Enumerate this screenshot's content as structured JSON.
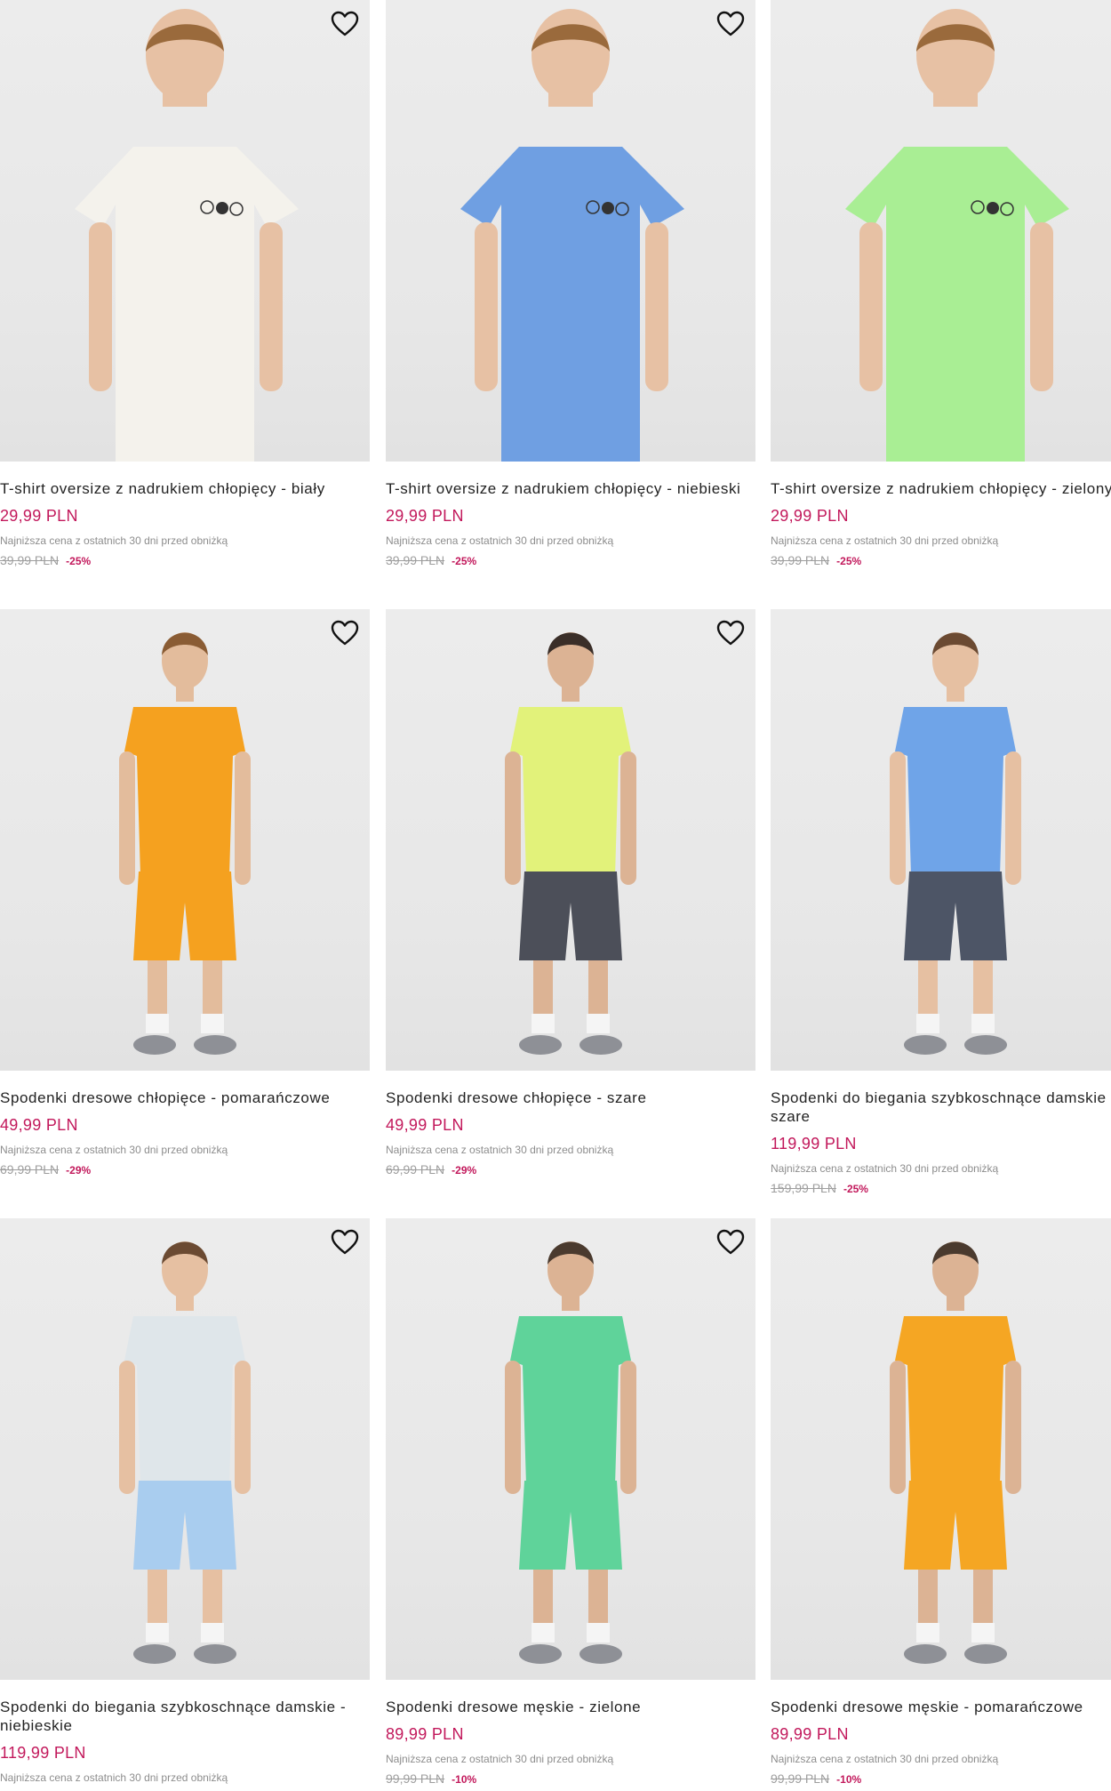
{
  "products": [
    {
      "title": "T-shirt oversize z nadrukiem chłopięcy - biały",
      "price": "29,99 PLN",
      "lowest_note": "Najniższa cena z ostatnich 30 dni przed obniżką",
      "old_price": "39,99 PLN",
      "discount": "-25%",
      "colors": {
        "top": "#f4f2ec",
        "bottom": "#f1eee6",
        "hair": "#9a6a3c",
        "skin": "#e7c1a4"
      }
    },
    {
      "title": "T-shirt oversize z nadrukiem chłopięcy - niebieski",
      "price": "29,99 PLN",
      "lowest_note": "Najniższa cena z ostatnich 30 dni przed obniżką",
      "old_price": "39,99 PLN",
      "discount": "-25%",
      "colors": {
        "top": "#6f9fe2",
        "bottom": "#6f9fe2",
        "hair": "#9a6a3c",
        "skin": "#e7c1a4"
      }
    },
    {
      "title": "T-shirt oversize z nadrukiem chłopięcy - zielony",
      "price": "29,99 PLN",
      "lowest_note": "Najniższa cena z ostatnich 30 dni przed obniżką",
      "old_price": "39,99 PLN",
      "discount": "-25%",
      "colors": {
        "top": "#a9ee94",
        "bottom": "#a9ee94",
        "hair": "#9a6a3c",
        "skin": "#e7c1a4"
      }
    },
    {
      "title": "Spodenki dresowe chłopięce - pomarańczowe",
      "price": "49,99 PLN",
      "lowest_note": "Najniższa cena z ostatnich 30 dni przed obniżką",
      "old_price": "69,99 PLN",
      "discount": "-29%",
      "colors": {
        "top": "#f5a11f",
        "bottom": "#f5a11f",
        "hair": "#8a5c34",
        "skin": "#e3bc9c"
      }
    },
    {
      "title": "Spodenki dresowe chłopięce - szare",
      "price": "49,99 PLN",
      "lowest_note": "Najniższa cena z ostatnich 30 dni przed obniżką",
      "old_price": "69,99 PLN",
      "discount": "-29%",
      "colors": {
        "top": "#e2f27a",
        "bottom": "#4c4f59",
        "hair": "#3a2e28",
        "skin": "#dcb394"
      }
    },
    {
      "title": "Spodenki do biegania szybkoschnące damskie - szare",
      "price": "119,99 PLN",
      "lowest_note": "Najniższa cena z ostatnich 30 dni przed obniżką",
      "old_price": "159,99 PLN",
      "discount": "-25%",
      "colors": {
        "top": "#6fa4e8",
        "bottom": "#4d5566",
        "hair": "#6b4a32",
        "skin": "#e6c0a2"
      }
    },
    {
      "title": "Spodenki do biegania szybkoschnące damskie - niebieskie",
      "price": "119,99 PLN",
      "lowest_note": "Najniższa cena z ostatnich 30 dni przed obniżką",
      "old_price": "",
      "discount": "",
      "colors": {
        "top": "#dfe6ea",
        "bottom": "#a9cdef",
        "hair": "#6b4a32",
        "skin": "#e6c0a2"
      }
    },
    {
      "title": "Spodenki dresowe męskie - zielone",
      "price": "89,99 PLN",
      "lowest_note": "Najniższa cena z ostatnich 30 dni przed obniżką",
      "old_price": "99,99 PLN",
      "discount": "-10%",
      "colors": {
        "top": "#5fd39a",
        "bottom": "#5fd39a",
        "hair": "#4a3a2e",
        "skin": "#dcb394"
      }
    },
    {
      "title": "Spodenki dresowe męskie - pomarańczowe",
      "price": "89,99 PLN",
      "lowest_note": "Najniższa cena z ostatnich 30 dni przed obniżką",
      "old_price": "99,99 PLN",
      "discount": "-10%",
      "colors": {
        "top": "#f5a623",
        "bottom": "#f5a623",
        "hair": "#4a3a2e",
        "skin": "#dcb394"
      }
    }
  ]
}
